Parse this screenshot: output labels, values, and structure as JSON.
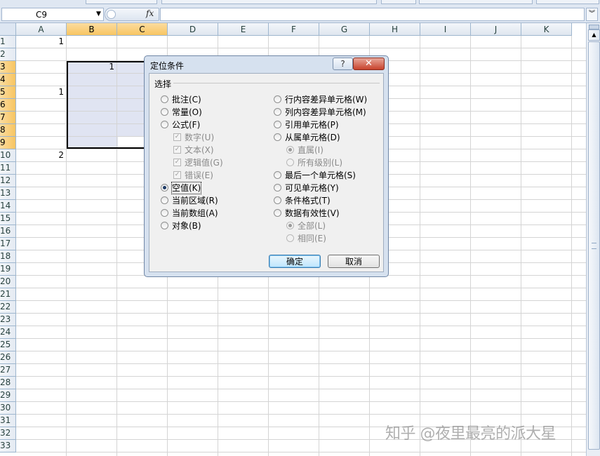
{
  "formula_bar": {
    "name_box": "C9",
    "fx_label": "fx",
    "formula": ""
  },
  "columns": [
    "A",
    "B",
    "C",
    "D",
    "E",
    "F",
    "G",
    "H",
    "I",
    "J",
    "K"
  ],
  "selected_columns": [
    "B",
    "C"
  ],
  "rows": [
    "1",
    "2",
    "3",
    "4",
    "5",
    "6",
    "7",
    "8",
    "9",
    "10",
    "11",
    "12",
    "13",
    "14",
    "15",
    "16",
    "17",
    "18",
    "19",
    "20",
    "21",
    "22",
    "23",
    "24",
    "25",
    "26",
    "27",
    "28",
    "29",
    "30",
    "31",
    "32",
    "33"
  ],
  "selected_rows": [
    "3",
    "4",
    "5",
    "6",
    "7",
    "8",
    "9"
  ],
  "cells": {
    "A1": "1",
    "B3": "1",
    "A5": "1",
    "A10": "2"
  },
  "dialog": {
    "title": "定位条件",
    "help_label": "?",
    "close_label": "✕",
    "group_label": "选择",
    "left_options": [
      {
        "label": "批注(C)",
        "checked": false
      },
      {
        "label": "常量(O)",
        "checked": false
      },
      {
        "label": "公式(F)",
        "checked": false
      },
      {
        "label": "空值(K)",
        "checked": true
      },
      {
        "label": "当前区域(R)",
        "checked": false
      },
      {
        "label": "当前数组(A)",
        "checked": false
      },
      {
        "label": "对象(B)",
        "checked": false
      }
    ],
    "formula_sub": [
      "数字(U)",
      "文本(X)",
      "逻辑值(G)",
      "错误(E)"
    ],
    "right_options": [
      {
        "label": "行内容差异单元格(W)",
        "checked": false
      },
      {
        "label": "列内容差异单元格(M)",
        "checked": false
      },
      {
        "label": "引用单元格(P)",
        "checked": false
      },
      {
        "label": "从属单元格(D)",
        "checked": false
      },
      {
        "label": "最后一个单元格(S)",
        "checked": false
      },
      {
        "label": "可见单元格(Y)",
        "checked": false
      },
      {
        "label": "条件格式(T)",
        "checked": false
      },
      {
        "label": "数据有效性(V)",
        "checked": false
      }
    ],
    "dependents_sub": [
      {
        "label": "直属(I)",
        "checked": true
      },
      {
        "label": "所有级别(L)",
        "checked": false
      }
    ],
    "validation_sub": [
      {
        "label": "全部(L)",
        "checked": true
      },
      {
        "label": "相同(E)",
        "checked": false
      }
    ],
    "ok_label": "确定",
    "cancel_label": "取消"
  },
  "watermark": "知乎 @夜里最亮的派大星"
}
